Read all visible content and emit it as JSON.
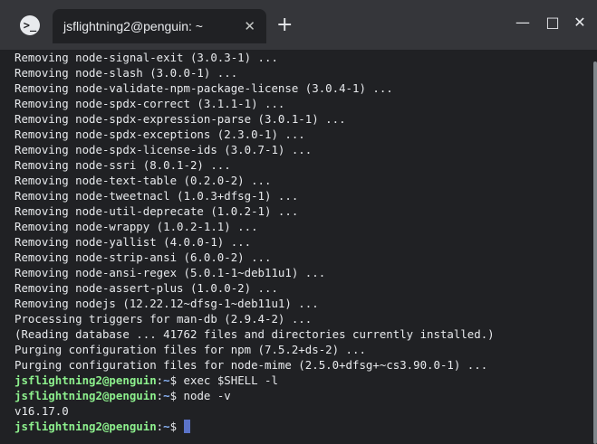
{
  "window": {
    "tab_title": "jsflightning2@penguin: ~",
    "app_icon": "terminal-icon",
    "tab_close_glyph": "✕",
    "new_tab_glyph": "+",
    "minimize_glyph": "—",
    "maximize_glyph": "□",
    "close_glyph": "✕"
  },
  "colors": {
    "background": "#202124",
    "titlebar": "#35363a",
    "text": "#e8eaed",
    "prompt_user": "#8df08d",
    "prompt_path": "#8ab4f8",
    "cursor": "#5b73c9"
  },
  "terminal": {
    "output_lines": [
      "Removing node-signal-exit (3.0.3-1) ...",
      "Removing node-slash (3.0.0-1) ...",
      "Removing node-validate-npm-package-license (3.0.4-1) ...",
      "Removing node-spdx-correct (3.1.1-1) ...",
      "Removing node-spdx-expression-parse (3.0.1-1) ...",
      "Removing node-spdx-exceptions (2.3.0-1) ...",
      "Removing node-spdx-license-ids (3.0.7-1) ...",
      "Removing node-ssri (8.0.1-2) ...",
      "Removing node-text-table (0.2.0-2) ...",
      "Removing node-tweetnacl (1.0.3+dfsg-1) ...",
      "Removing node-util-deprecate (1.0.2-1) ...",
      "Removing node-wrappy (1.0.2-1.1) ...",
      "Removing node-yallist (4.0.0-1) ...",
      "Removing node-strip-ansi (6.0.0-2) ...",
      "Removing node-ansi-regex (5.0.1-1~deb11u1) ...",
      "Removing node-assert-plus (1.0.0-2) ...",
      "Removing nodejs (12.22.12~dfsg-1~deb11u1) ...",
      "Processing triggers for man-db (2.9.4-2) ...",
      "(Reading database ... 41762 files and directories currently installed.)",
      "Purging configuration files for npm (7.5.2+ds-2) ...",
      "Purging configuration files for node-mime (2.5.0+dfsg+~cs3.90.0-1) ..."
    ],
    "prompt_user": "jsflightning2@penguin",
    "prompt_path": "~",
    "prompt_symbol": "$",
    "session": [
      {
        "type": "command",
        "text": "exec $SHELL -l"
      },
      {
        "type": "command",
        "text": "node -v"
      },
      {
        "type": "output",
        "text": "v16.17.0"
      },
      {
        "type": "active",
        "text": ""
      }
    ]
  },
  "scrollbar": {
    "thumb_fraction": 0.97
  }
}
